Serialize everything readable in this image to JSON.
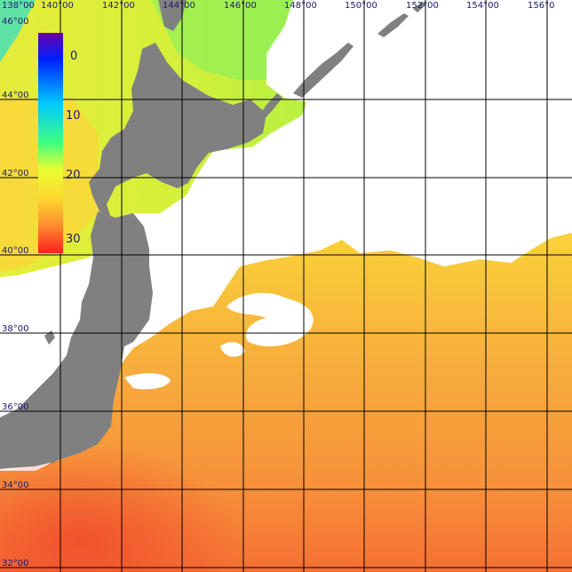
{
  "map": {
    "type": "sea-surface-temperature",
    "lon_labels": [
      "138°00",
      "140°00",
      "142°00",
      "144°00",
      "146°00",
      "148°00",
      "150°00",
      "152°00",
      "154°00",
      "156°0"
    ],
    "lat_labels": [
      "46°00",
      "44°00",
      "42°00",
      "40°00",
      "38°00",
      "36°00",
      "34°00",
      "32°00"
    ],
    "colors": {
      "land": "#808080",
      "no_data": "#ffffff",
      "grid": "#000000",
      "label": "#1a1a6e"
    }
  },
  "colorbar": {
    "ticks": [
      "0",
      "10",
      "20",
      "30"
    ],
    "stops": [
      "#6a00a8",
      "#0020ff",
      "#00c8ff",
      "#40ff80",
      "#e8ff30",
      "#ffd830",
      "#ff9030",
      "#ff2020"
    ]
  }
}
